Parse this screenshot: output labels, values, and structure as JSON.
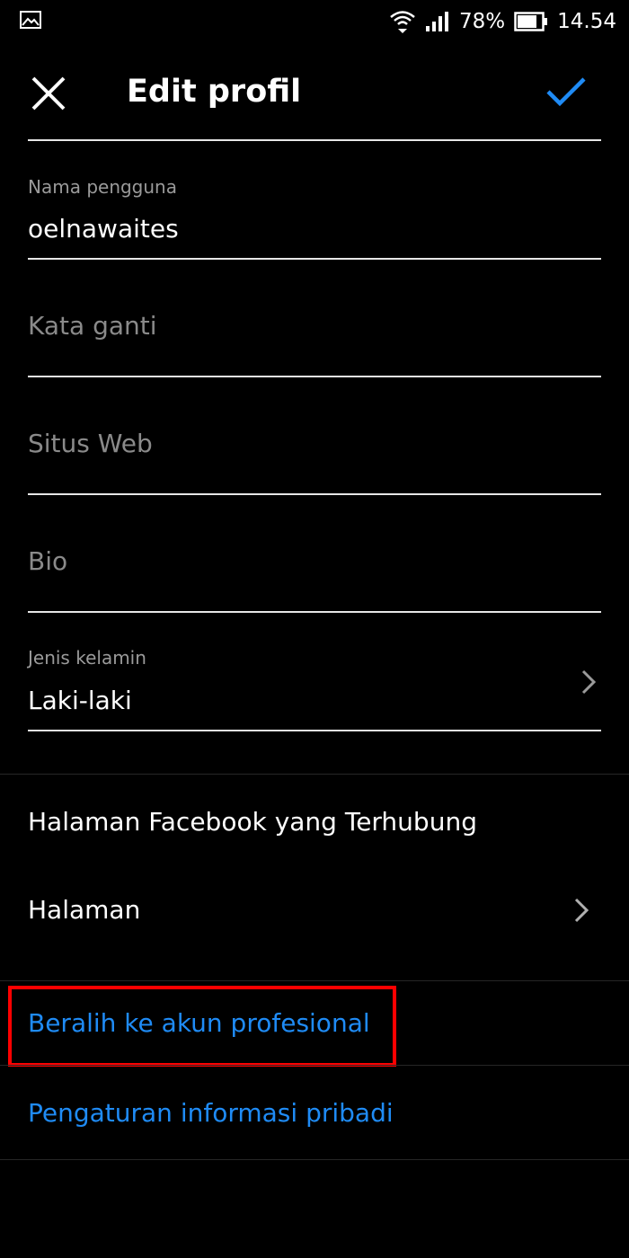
{
  "status_bar": {
    "battery_percent": "78%",
    "time": "14.54",
    "icons": [
      "gallery-icon",
      "wifi-icon",
      "signal-icon",
      "battery-icon"
    ]
  },
  "header": {
    "title": "Edit profil",
    "close_icon": "close-icon",
    "confirm_icon": "checkmark-icon"
  },
  "fields": {
    "username": {
      "label": "Nama pengguna",
      "value": "oelnawaites"
    },
    "pronoun": {
      "placeholder": "Kata ganti"
    },
    "website": {
      "placeholder": "Situs Web"
    },
    "bio": {
      "placeholder": "Bio"
    },
    "gender": {
      "label": "Jenis kelamin",
      "value": "Laki-laki"
    }
  },
  "facebook": {
    "section_title": "Halaman Facebook yang Terhubung",
    "page_label": "Halaman"
  },
  "links": {
    "professional": "Beralih ke akun profesional",
    "personal_info": "Pengaturan informasi pribadi"
  },
  "colors": {
    "accent": "#1f8bf5",
    "highlight": "#ff0000",
    "background": "#000000"
  }
}
